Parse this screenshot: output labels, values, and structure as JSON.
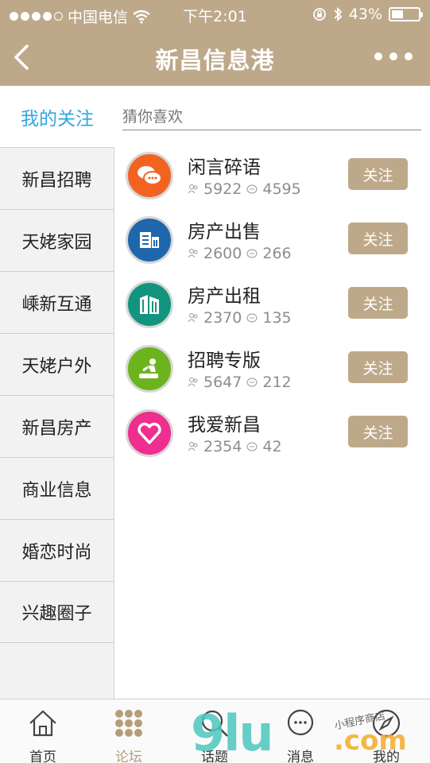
{
  "status_bar": {
    "carrier": "中国电信",
    "time": "下午2:01",
    "battery_percent": "43%",
    "battery_level": 0.43,
    "signal_bars_filled": 4,
    "signal_bars_total": 5,
    "icons": [
      "wifi-icon",
      "orientation-lock-icon",
      "bluetooth-icon",
      "battery-icon"
    ]
  },
  "nav": {
    "title": "新昌信息港",
    "back_icon": "chevron-left-icon",
    "more_icon": "more-dots-icon"
  },
  "sidebar": {
    "active_label": "我的关注",
    "items": [
      {
        "label": "新昌招聘"
      },
      {
        "label": "天姥家园"
      },
      {
        "label": "嵊新互通"
      },
      {
        "label": "天姥户外"
      },
      {
        "label": "新昌房产"
      },
      {
        "label": "商业信息"
      },
      {
        "label": "婚恋时尚"
      },
      {
        "label": "兴趣圈子"
      }
    ]
  },
  "main": {
    "section_label": "猜你喜欢",
    "follow_label": "关注",
    "forums": [
      {
        "name": "闲言碎语",
        "members": "5922",
        "posts": "4595",
        "color": "#f26322",
        "icon": "chat-bubbles-icon"
      },
      {
        "name": "房产出售",
        "members": "2600",
        "posts": "266",
        "color": "#1f67ad",
        "icon": "building-icon"
      },
      {
        "name": "房产出租",
        "members": "2370",
        "posts": "135",
        "color": "#13947f",
        "icon": "towers-icon"
      },
      {
        "name": "招聘专版",
        "members": "5647",
        "posts": "212",
        "color": "#6cb41e",
        "icon": "worker-icon"
      },
      {
        "name": "我爱新昌",
        "members": "2354",
        "posts": "42",
        "color": "#ee2f8f",
        "icon": "heart-icon"
      }
    ]
  },
  "tabbar": {
    "tabs": [
      {
        "label": "首页",
        "icon": "home-icon"
      },
      {
        "label": "论坛",
        "icon": "grid-dots-icon",
        "active": true
      },
      {
        "label": "话题",
        "icon": "search-icon"
      },
      {
        "label": "消息",
        "icon": "message-icon"
      },
      {
        "label": "我的",
        "icon": "compass-icon"
      }
    ]
  },
  "watermark": {
    "text": "9lu.com",
    "small": "小程序商店"
  },
  "colors": {
    "accent": "#bda98a",
    "active_text": "#2fa7e0",
    "tab_active": "#b49e77"
  }
}
